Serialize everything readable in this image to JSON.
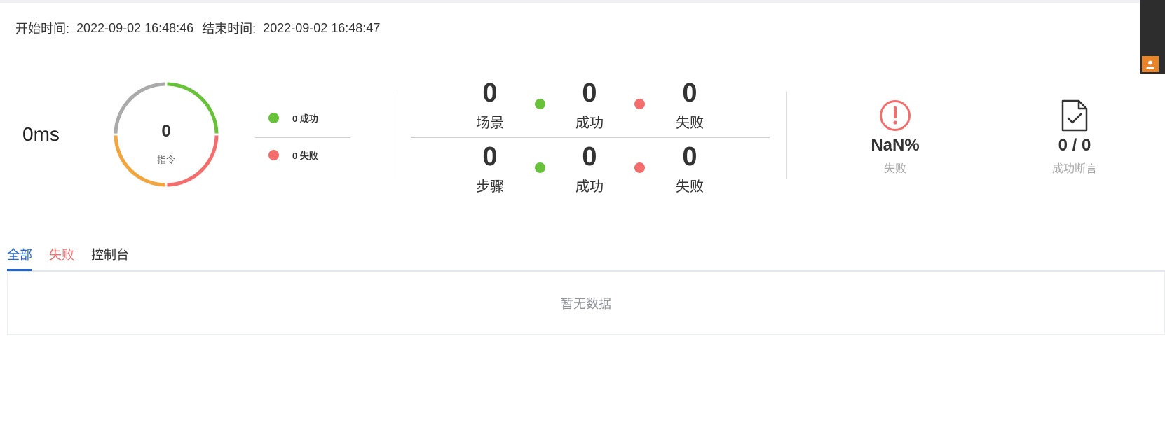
{
  "time": {
    "start_label": "开始时间:",
    "start_value": "2022-09-02 16:48:46",
    "end_label": "结束时间:",
    "end_value": "2022-09-02 16:48:47"
  },
  "duration": "0ms",
  "donut": {
    "value": "0",
    "label": "指令"
  },
  "legend": {
    "success": "0 成功",
    "fail": "0 失败"
  },
  "counts": {
    "scenario": {
      "total": "0",
      "total_label": "场景",
      "success": "0",
      "success_label": "成功",
      "fail": "0",
      "fail_label": "失败"
    },
    "step": {
      "total": "0",
      "total_label": "步骤",
      "success": "0",
      "success_label": "成功",
      "fail": "0",
      "fail_label": "失败"
    }
  },
  "stats": {
    "fail_rate": {
      "value": "NaN%",
      "label": "失败",
      "icon": "exclamation-circle-icon"
    },
    "assertions": {
      "value": "0 / 0",
      "label": "成功断言",
      "icon": "document-check-icon"
    }
  },
  "tabs": [
    {
      "label": "全部",
      "active": true
    },
    {
      "label": "失败",
      "active": false
    },
    {
      "label": "控制台",
      "active": false
    }
  ],
  "empty_text": "暂无数据",
  "colors": {
    "success": "#67c23a",
    "fail": "#f36d6d",
    "pending": "#aaaaaa",
    "warning": "#f2a53d",
    "accent": "#1f64d8"
  }
}
